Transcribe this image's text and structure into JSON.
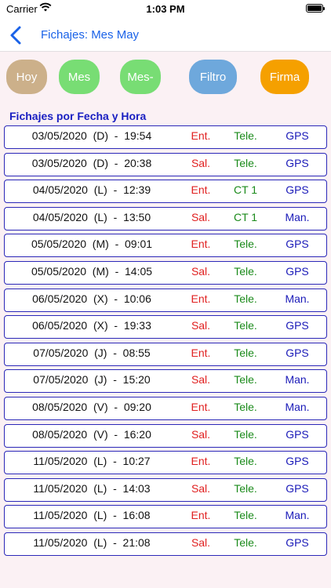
{
  "status": {
    "carrier": "Carrier",
    "time": "1:03 PM"
  },
  "nav": {
    "title": "Fichajes: Mes May"
  },
  "buttons": [
    {
      "label": "Hoy",
      "color": "#ccb08a"
    },
    {
      "label": "Mes",
      "color": "#78dd74"
    },
    {
      "label": "Mes-",
      "color": "#78dd74"
    },
    {
      "label": "Filtro",
      "color": "#6ea8dc"
    },
    {
      "label": "Firma",
      "color": "#f5a000"
    }
  ],
  "section": {
    "title": "Fichajes por Fecha y Hora"
  },
  "colors": {
    "entrada": "#e02020",
    "salida": "#e02020",
    "lugar": "#1a8a1a",
    "metodo": "#1a1ab8"
  },
  "rows": [
    {
      "datetime": "03/05/2020  (D)  -  19:54",
      "tipo": "Ent.",
      "lugar": "Tele.",
      "metodo": "GPS"
    },
    {
      "datetime": "03/05/2020  (D)  -  20:38",
      "tipo": "Sal.",
      "lugar": "Tele.",
      "metodo": "GPS"
    },
    {
      "datetime": "04/05/2020  (L)  -  12:39",
      "tipo": "Ent.",
      "lugar": "CT 1",
      "metodo": "GPS"
    },
    {
      "datetime": "04/05/2020  (L)  -  13:50",
      "tipo": "Sal.",
      "lugar": "CT 1",
      "metodo": "Man."
    },
    {
      "datetime": "05/05/2020  (M)  -  09:01",
      "tipo": "Ent.",
      "lugar": "Tele.",
      "metodo": "GPS"
    },
    {
      "datetime": "05/05/2020  (M)  -  14:05",
      "tipo": "Sal.",
      "lugar": "Tele.",
      "metodo": "GPS"
    },
    {
      "datetime": "06/05/2020  (X)  -  10:06",
      "tipo": "Ent.",
      "lugar": "Tele.",
      "metodo": "Man."
    },
    {
      "datetime": "06/05/2020  (X)  -  19:33",
      "tipo": "Sal.",
      "lugar": "Tele.",
      "metodo": "GPS"
    },
    {
      "datetime": "07/05/2020  (J)  -  08:55",
      "tipo": "Ent.",
      "lugar": "Tele.",
      "metodo": "GPS"
    },
    {
      "datetime": "07/05/2020  (J)  -  15:20",
      "tipo": "Sal.",
      "lugar": "Tele.",
      "metodo": "Man."
    },
    {
      "datetime": "08/05/2020  (V)  -  09:20",
      "tipo": "Ent.",
      "lugar": "Tele.",
      "metodo": "Man."
    },
    {
      "datetime": "08/05/2020  (V)  -  16:20",
      "tipo": "Sal.",
      "lugar": "Tele.",
      "metodo": "GPS"
    },
    {
      "datetime": "11/05/2020  (L)  -  10:27",
      "tipo": "Ent.",
      "lugar": "Tele.",
      "metodo": "GPS"
    },
    {
      "datetime": "11/05/2020  (L)  -  14:03",
      "tipo": "Sal.",
      "lugar": "Tele.",
      "metodo": "GPS"
    },
    {
      "datetime": "11/05/2020  (L)  -  16:08",
      "tipo": "Ent.",
      "lugar": "Tele.",
      "metodo": "Man."
    },
    {
      "datetime": "11/05/2020  (L)  -  21:08",
      "tipo": "Sal.",
      "lugar": "Tele.",
      "metodo": "GPS"
    }
  ]
}
